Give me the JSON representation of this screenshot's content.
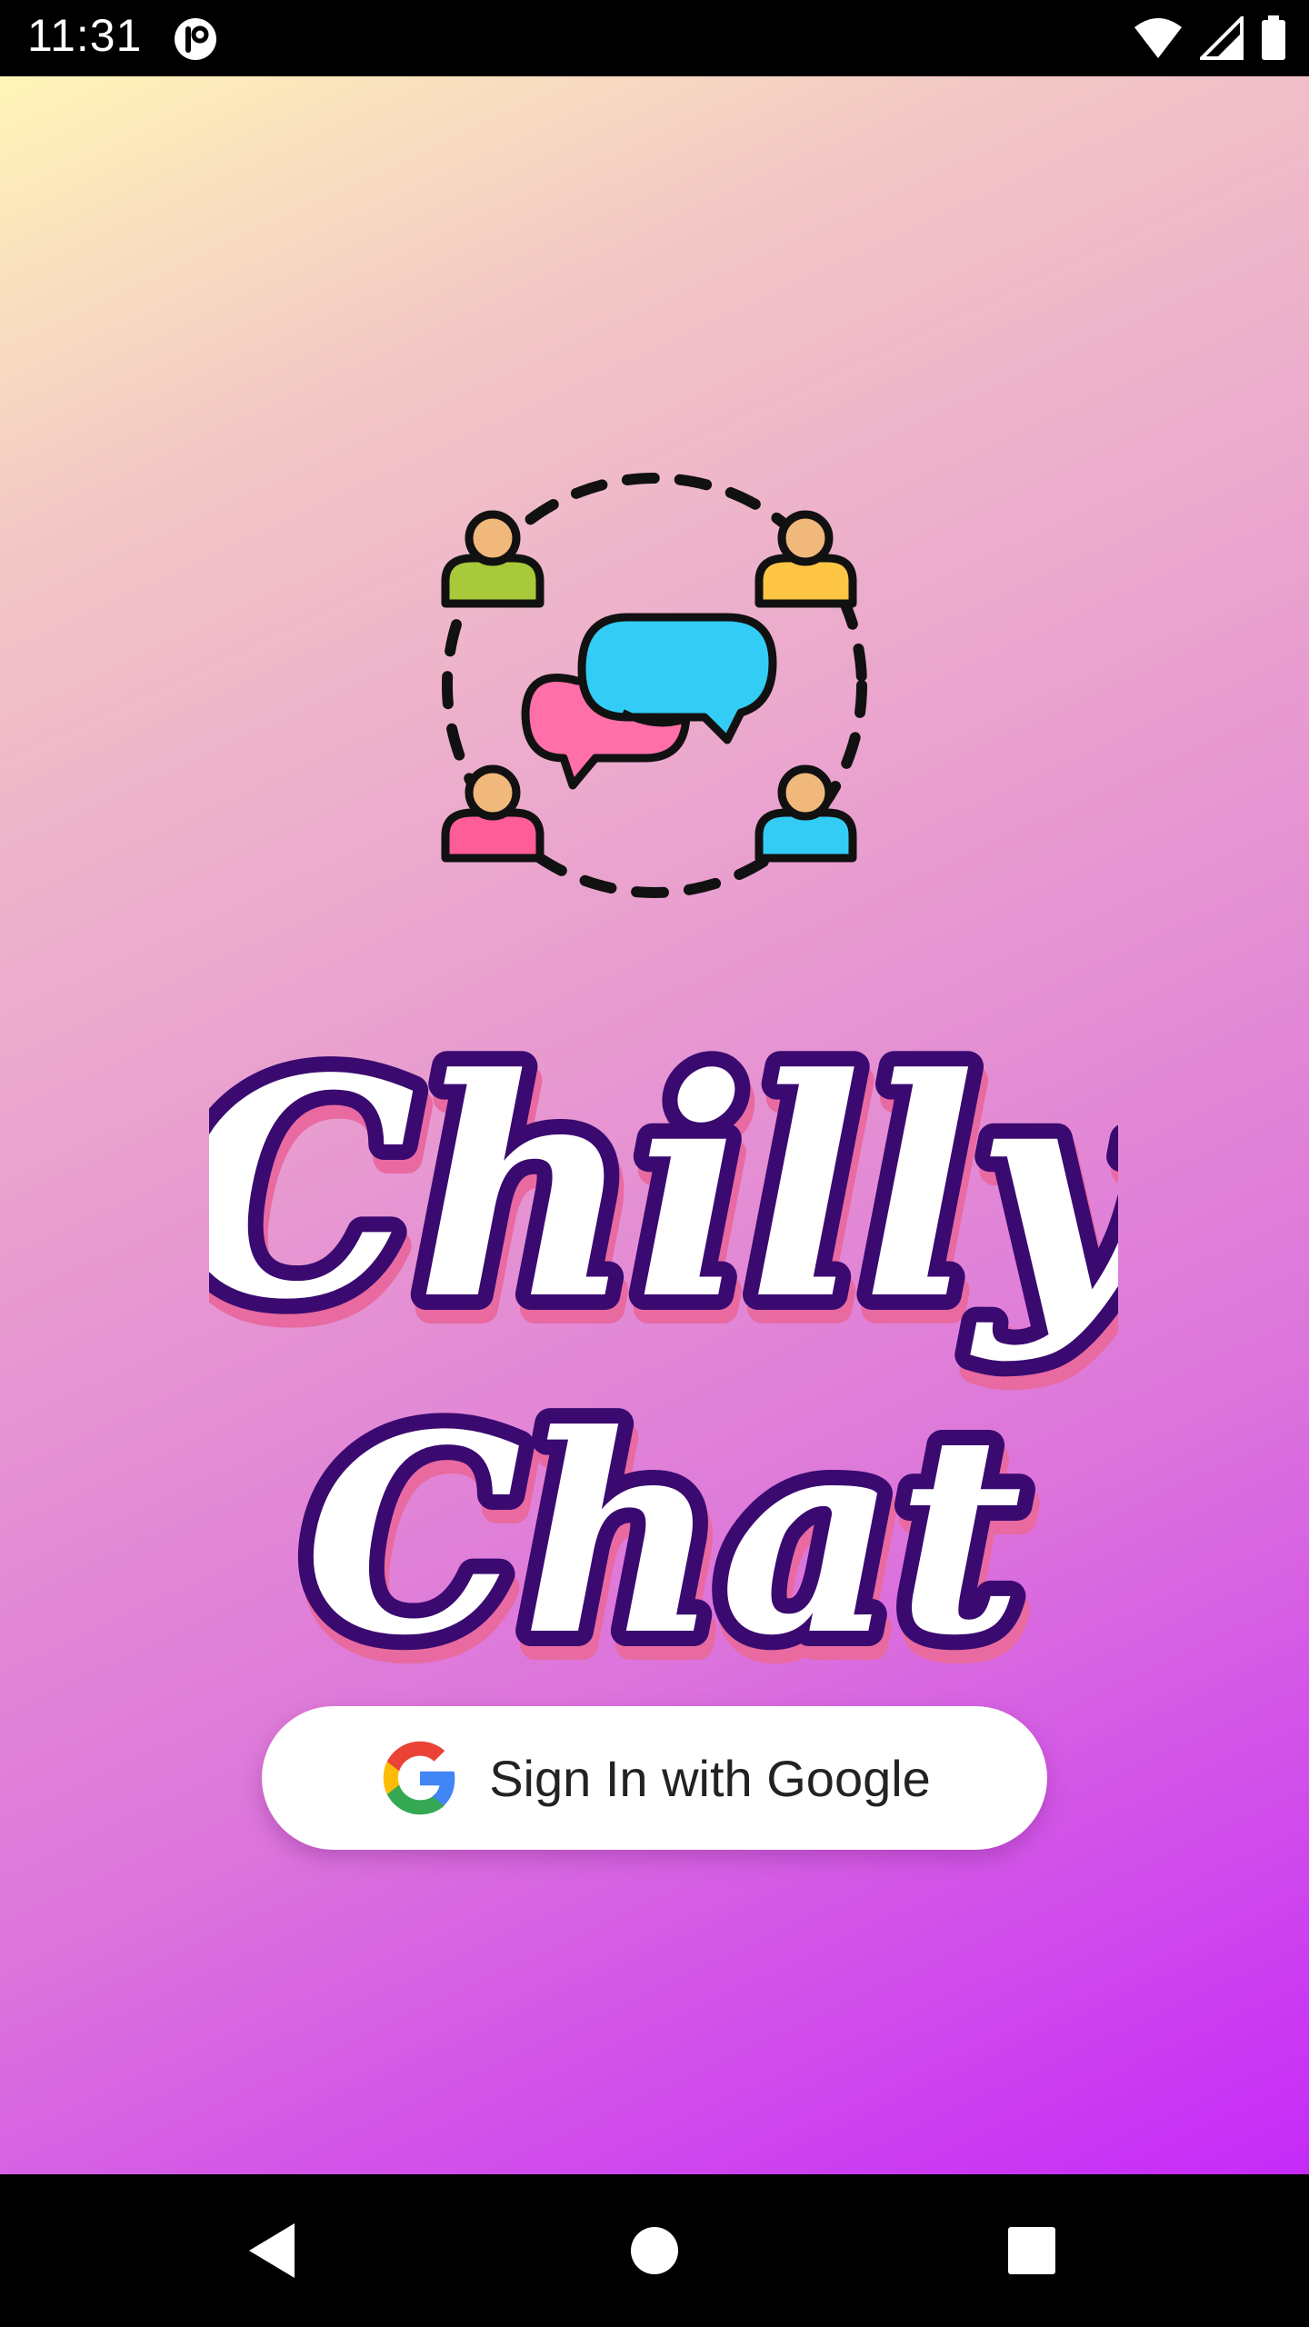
{
  "status_bar": {
    "time": "11:31",
    "icons": [
      "app-notification-icon",
      "wifi-icon",
      "signal-icon",
      "battery-icon"
    ]
  },
  "app": {
    "title_line1": "Chilly",
    "title_line2": "Chat",
    "logo_icon": "group-chat-icon",
    "sign_in_button": {
      "label": "Sign In with Google",
      "icon": "google-icon"
    }
  },
  "colors": {
    "gradient_start": "#fff5b8",
    "gradient_end": "#c62af8",
    "title_outline": "#3a0a70",
    "title_fill": "#ffffff",
    "bubble_blue": "#33ccf5",
    "bubble_pink": "#ff6fa8"
  },
  "nav_bar": {
    "buttons": [
      "back-icon",
      "home-icon",
      "recents-icon"
    ]
  }
}
